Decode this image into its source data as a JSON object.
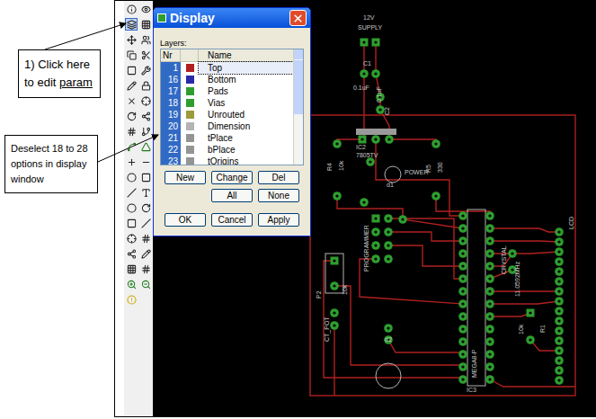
{
  "annotations": [
    {
      "text": "1) Click here to edit",
      "underlined": "param"
    },
    {
      "text": "Deselect 18 to 28 options in display window",
      "underlined": ""
    }
  ],
  "dialog": {
    "title": "Display",
    "layers_label": "Layers:",
    "columns": [
      "Nr",
      "Name"
    ],
    "layers": [
      {
        "nr": "1",
        "name": "Top",
        "color": "#b02020",
        "selected": true,
        "focused": true
      },
      {
        "nr": "16",
        "name": "Bottom",
        "color": "#2a2aa8",
        "selected": true,
        "focused": false
      },
      {
        "nr": "17",
        "name": "Pads",
        "color": "#2e9e2e",
        "selected": true,
        "focused": false
      },
      {
        "nr": "18",
        "name": "Vias",
        "color": "#2e9e2e",
        "selected": true,
        "focused": false
      },
      {
        "nr": "19",
        "name": "Unrouted",
        "color": "#9c9c3a",
        "selected": true,
        "focused": false
      },
      {
        "nr": "20",
        "name": "Dimension",
        "color": "#b4b4b4",
        "selected": true,
        "focused": false
      },
      {
        "nr": "21",
        "name": "tPlace",
        "color": "#949494",
        "selected": true,
        "focused": false
      },
      {
        "nr": "22",
        "name": "bPlace",
        "color": "#949494",
        "selected": true,
        "focused": false
      },
      {
        "nr": "23",
        "name": "tOrigins",
        "color": "#949494",
        "selected": true,
        "focused": false
      }
    ],
    "button_rows": [
      [
        "New",
        "Change",
        "Del"
      ],
      [
        "All",
        "None"
      ],
      [
        "OK",
        "Cancel",
        "Apply"
      ]
    ]
  },
  "pcb": {
    "labels": [
      "12V",
      "SUPPLY",
      "C1",
      "0.1uF",
      "C2",
      "0.1uF",
      "IC2",
      "7805TV",
      "POWER",
      "d1",
      "R4",
      "10k",
      "R5",
      "330",
      "PROGRAMMER",
      "MEGA8-P",
      "IC3",
      "CRYSTAL",
      "11.0592MHz",
      "R1",
      "10k",
      "LCD",
      "P2",
      "10k",
      "CT_POT",
      "d2"
    ]
  }
}
